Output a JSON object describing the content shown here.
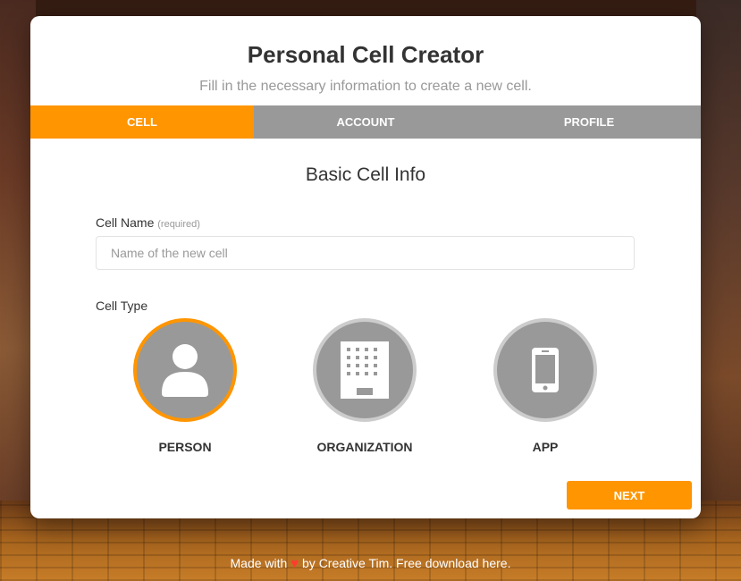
{
  "header": {
    "title": "Personal Cell Creator",
    "subtitle": "Fill in the necessary information to create a new cell."
  },
  "tabs": [
    {
      "label": "CELL",
      "active": true
    },
    {
      "label": "ACCOUNT",
      "active": false
    },
    {
      "label": "PROFILE",
      "active": false
    }
  ],
  "section": {
    "title": "Basic Cell Info"
  },
  "cell_name": {
    "label": "Cell Name",
    "required_note": "(required)",
    "placeholder": "Name of the new cell",
    "value": ""
  },
  "cell_type": {
    "label": "Cell Type",
    "options": [
      {
        "label": "PERSON",
        "icon": "person-icon",
        "selected": true
      },
      {
        "label": "ORGANIZATION",
        "icon": "building-icon",
        "selected": false
      },
      {
        "label": "APP",
        "icon": "phone-icon",
        "selected": false
      }
    ]
  },
  "actions": {
    "next_label": "NEXT"
  },
  "footer": {
    "made_with": "Made with",
    "heart_icon": "heart-icon",
    "suffix": "by Creative Tim. Free download here."
  },
  "colors": {
    "accent": "#ff9500",
    "tab_bg": "#999999",
    "heart": "#ff3b30"
  }
}
